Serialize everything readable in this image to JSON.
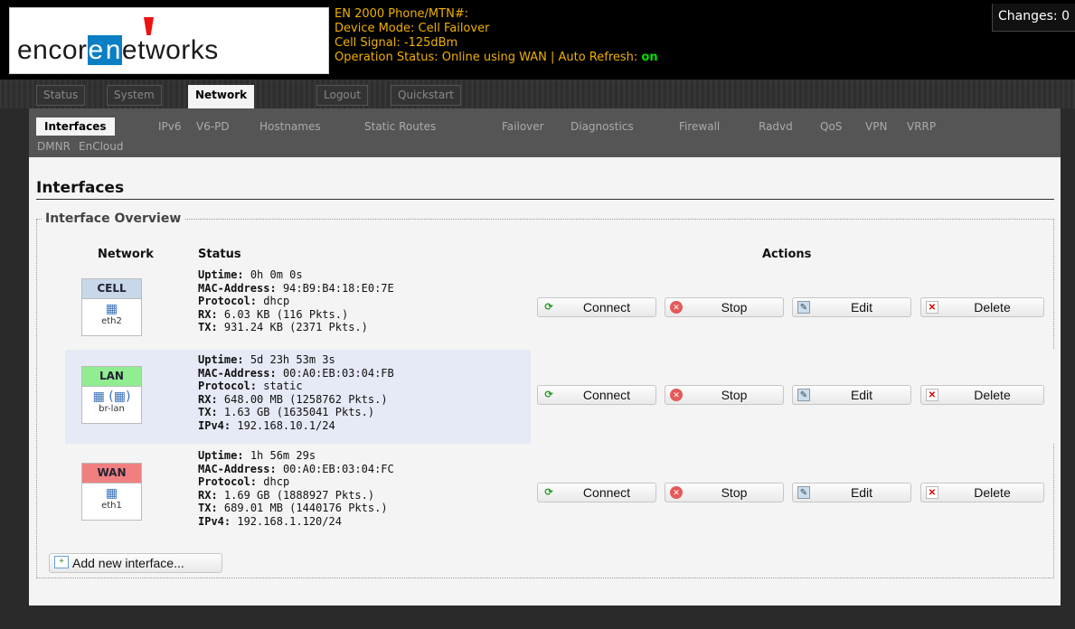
{
  "header": {
    "logo_text": "encore networks",
    "logo_pre": "encor",
    "logo_e": "e",
    "logo_n": "n",
    "logo_post": "etworks",
    "info_line1": "EN 2000 Phone/MTN#:",
    "info_line2": "Device Mode: Cell Failover",
    "info_line3": "Cell Signal: -125dBm",
    "info_line4_prefix": "Operation Status: Online using WAN | Auto Refresh: ",
    "auto_refresh_state": "on",
    "changes": "Changes: 0"
  },
  "main_nav": {
    "tabs": [
      "Status",
      "System",
      "Network",
      "Logout",
      "Quickstart"
    ],
    "active": "Network"
  },
  "sub_nav": {
    "items": [
      "Interfaces",
      "IPv6",
      "V6-PD",
      "Hostnames",
      "Static Routes",
      "Failover",
      "Diagnostics",
      "Firewall",
      "Radvd",
      "QoS",
      "VPN",
      "VRRP",
      "DMNR",
      "EnCloud"
    ],
    "active": "Interfaces"
  },
  "page_title": "Interfaces",
  "overview": {
    "legend": "Interface Overview",
    "col_network": "Network",
    "col_status": "Status",
    "col_actions": "Actions",
    "add_label": "Add new interface..."
  },
  "buttons": {
    "connect": "Connect",
    "stop": "Stop",
    "edit": "Edit",
    "delete": "Delete"
  },
  "interfaces": [
    {
      "name": "CELL",
      "color": "#c8d8ea",
      "device": "eth2",
      "icon": "network-port-icon",
      "uptime_label": "Uptime:",
      "uptime": "0h 0m 0s",
      "mac_label": "MAC-Address:",
      "mac": "94:B9:B4:18:E0:7E",
      "protocol_label": "Protocol:",
      "protocol": "dhcp",
      "rx_label": "RX:",
      "rx": "6.03 KB (116 Pkts.)",
      "tx_label": "TX:",
      "tx": "931.24 KB (2371 Pkts.)"
    },
    {
      "name": "LAN",
      "color": "#90ee90",
      "device": "br-lan",
      "icon": "bridge-icon",
      "icon_text": "( )",
      "uptime_label": "Uptime:",
      "uptime": "5d 23h 53m 3s",
      "mac_label": "MAC-Address:",
      "mac": "00:A0:EB:03:04:FB",
      "protocol_label": "Protocol:",
      "protocol": "static",
      "rx_label": "RX:",
      "rx": "648.00 MB (1258762 Pkts.)",
      "tx_label": "TX:",
      "tx": "1.63 GB (1635041 Pkts.)",
      "ipv4_label": "IPv4:",
      "ipv4": "192.168.10.1/24"
    },
    {
      "name": "WAN",
      "color": "#f08080",
      "device": "eth1",
      "icon": "network-port-icon",
      "uptime_label": "Uptime:",
      "uptime": "1h 56m 29s",
      "mac_label": "MAC-Address:",
      "mac": "00:A0:EB:03:04:FC",
      "protocol_label": "Protocol:",
      "protocol": "dhcp",
      "rx_label": "RX:",
      "rx": "1.69 GB (1888927 Pkts.)",
      "tx_label": "TX:",
      "tx": "689.01 MB (1440176 Pkts.)",
      "ipv4_label": "IPv4:",
      "ipv4": "192.168.1.120/24"
    }
  ]
}
